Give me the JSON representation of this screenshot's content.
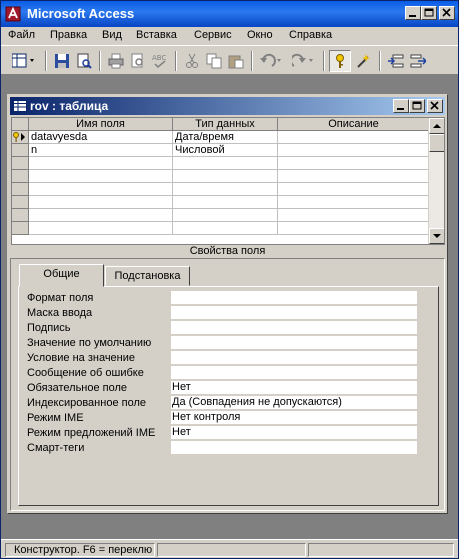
{
  "app": {
    "title": "Microsoft Access"
  },
  "menu": [
    "Файл",
    "Правка",
    "Вид",
    "Вставка",
    "Сервис",
    "Окно",
    "Справка"
  ],
  "toolbar": {
    "buttons": [
      "view-design-icon",
      "save-icon",
      "search-file-icon",
      "print-icon",
      "print-preview-icon",
      "spelling-icon",
      "cut-icon",
      "copy-icon",
      "paste-icon",
      "undo-icon",
      "redo-icon",
      "primary-key-icon",
      "build-icon",
      "insert-rows-icon",
      "delete-rows-icon"
    ]
  },
  "table_window": {
    "title": "rov : таблица",
    "columns": [
      "Имя поля",
      "Тип данных",
      "Описание"
    ],
    "rows": [
      {
        "name": "datavyesda",
        "type": "Дата/время",
        "description": "",
        "primary_key": true
      },
      {
        "name": "n",
        "type": "Числовой",
        "description": "",
        "primary_key": false
      },
      {
        "name": "",
        "type": "",
        "description": ""
      },
      {
        "name": "",
        "type": "",
        "description": ""
      },
      {
        "name": "",
        "type": "",
        "description": ""
      },
      {
        "name": "",
        "type": "",
        "description": ""
      },
      {
        "name": "",
        "type": "",
        "description": ""
      },
      {
        "name": "",
        "type": "",
        "description": ""
      }
    ],
    "properties_label": "Свойства поля",
    "tabs": [
      "Общие",
      "Подстановка"
    ],
    "properties": [
      {
        "label": "Формат поля",
        "value": ""
      },
      {
        "label": "Маска ввода",
        "value": ""
      },
      {
        "label": "Подпись",
        "value": ""
      },
      {
        "label": "Значение по умолчанию",
        "value": ""
      },
      {
        "label": "Условие на значение",
        "value": ""
      },
      {
        "label": "Сообщение об ошибке",
        "value": ""
      },
      {
        "label": "Обязательное поле",
        "value": "Нет"
      },
      {
        "label": "Индексированное поле",
        "value": "Да (Совпадения не допускаются)"
      },
      {
        "label": "Режим IME",
        "value": "Нет контроля"
      },
      {
        "label": "Режим предложений IME",
        "value": "Нет"
      },
      {
        "label": "Смарт-теги",
        "value": ""
      }
    ]
  },
  "status": {
    "text": "Конструктор.  F6 = переклю"
  }
}
